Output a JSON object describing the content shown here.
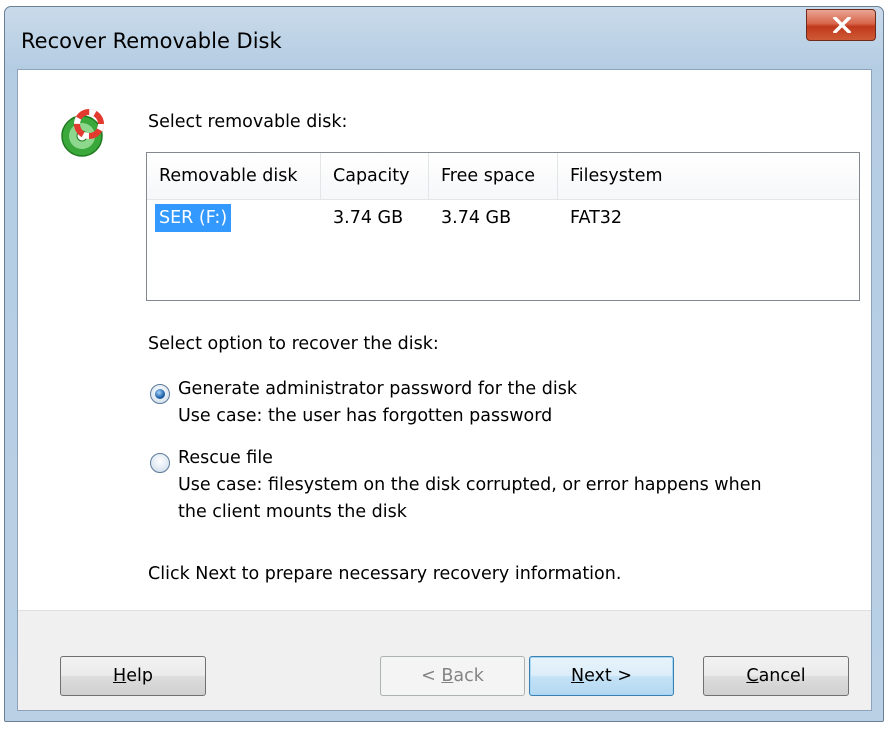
{
  "window": {
    "title": "Recover Removable Disk",
    "close_glyph": "✕"
  },
  "icon": {
    "name": "disk-recovery-icon",
    "colors": {
      "disc": "#3aa83a",
      "ring": "#e23a2f"
    }
  },
  "disk_section": {
    "label": "Select removable disk:",
    "columns": [
      "Removable disk",
      "Capacity",
      "Free space",
      "Filesystem"
    ],
    "rows": [
      {
        "disk": "SER (F:)",
        "capacity": "3.74 GB",
        "free": "3.74 GB",
        "fs": "FAT32",
        "selected": true
      }
    ]
  },
  "options_section": {
    "label": "Select option to recover the disk:",
    "options": [
      {
        "title": "Generate administrator password for the disk",
        "desc": "Use case: the user has forgotten password",
        "desc2": "",
        "checked": true
      },
      {
        "title": "Rescue file",
        "desc": "Use case: filesystem on the disk corrupted, or error happens when",
        "desc2": "the client mounts the disk",
        "checked": false
      }
    ]
  },
  "hint": "Click Next to prepare necessary recovery information.",
  "buttons": {
    "help": {
      "pre": "",
      "acc": "H",
      "post": "elp"
    },
    "back": {
      "pre": "< ",
      "acc": "B",
      "post": "ack",
      "enabled": false
    },
    "next": {
      "pre": "",
      "acc": "N",
      "post": "ext >",
      "default": true
    },
    "cancel": {
      "pre": "",
      "acc": "C",
      "post": "ancel"
    }
  },
  "colors": {
    "selection": "#3399ff",
    "title_bar": "#b9d1ea",
    "close_button": "#c7472a"
  }
}
